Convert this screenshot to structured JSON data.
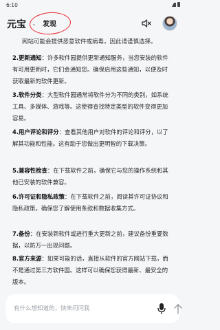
{
  "status_bar": {
    "time": "6:10"
  },
  "header": {
    "brand": "元宝",
    "brand_chevron": "⌄",
    "tab_discover": "发现",
    "mute_icon": "speaker-muted-icon",
    "avatar_icon": "user-avatar"
  },
  "content": {
    "intro": "网站可能会提供恶意软件或病毒，因此请谨慎选择。",
    "items": [
      {
        "num": "2.",
        "title": "更新通知",
        "text": "：许多软件园提供更新通知服务，当您安装的软件有可用更新时，它们会通知您。确保启用这些通知，以便及时获取最新的软件更新。"
      },
      {
        "num": "3.",
        "title": "软件分类",
        "text": "：大型软件园通常将软件分为不同的类别，如系统工具、多媒体、游戏等。这使得查找特定类型的软件变得更加容易。"
      },
      {
        "num": "4.",
        "title": "用户评论和评分",
        "text": "：查看其他用户对软件的评论和评分，以了解其功能和性能。这有助于您做出更明智的下载决策。"
      },
      {
        "num": "5.",
        "title": "兼容性检查",
        "text": "：在下载软件之前，确保它与您的操作系统和其他已安装的软件兼容。"
      },
      {
        "num": "6.",
        "title": "许可证和隐私政策",
        "text": "：在下载软件之前，阅读其许可证协议和隐私政策，确保您了解使用条款和数据收集方式。"
      },
      {
        "num": "7.",
        "title": "备份",
        "text": "：在安装新软件或进行重大更新之前，建议备份重要数据，以防万一出现问题。"
      },
      {
        "num": "8.",
        "title": "官方来源",
        "text": "：如果可能的话，直接从软件的官方网站下载，而不是通过第三方软件园。这样可以确保您获得最新、最安全的版本。"
      }
    ]
  },
  "input": {
    "placeholder": "有什么想知道的，快来问问我",
    "mic_icon": "microphone-icon",
    "send_icon": "send-icon"
  },
  "colors": {
    "highlight_ring": "#e8232a",
    "background": "#f5f6f8"
  }
}
